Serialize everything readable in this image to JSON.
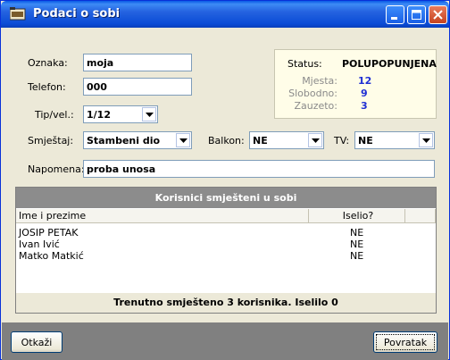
{
  "window": {
    "title": "Podaci o sobi"
  },
  "form": {
    "oznaka_label": "Oznaka:",
    "oznaka_value": "moja",
    "telefon_label": "Telefon:",
    "telefon_value": "000",
    "tip_label": "Tip/vel.:",
    "tip_value": "1/12",
    "smjestaj_label": "Smještaj:",
    "smjestaj_value": "Stambeni dio",
    "balkon_label": "Balkon:",
    "balkon_value": "NE",
    "tv_label": "TV:",
    "tv_value": "NE",
    "napomena_label": "Napomena:",
    "napomena_value": "proba unosa"
  },
  "status": {
    "status_label": "Status:",
    "status_value": "POLUPOPUNJENA",
    "mjesta_label": "Mjesta:",
    "mjesta_value": "12",
    "slobodno_label": "Slobodno:",
    "slobodno_value": "9",
    "zauzeto_label": "Zauzeto:",
    "zauzeto_value": "3",
    "value_color": "#1f2fd4"
  },
  "grid": {
    "title": "Korisnici smješteni u sobi",
    "columns": [
      "Ime i prezime",
      "Iselio?"
    ],
    "rows": [
      {
        "name": "JOSIP PETAK",
        "iselio": "NE"
      },
      {
        "name": "Ivan Ivić",
        "iselio": "NE"
      },
      {
        "name": "Matko Matkić",
        "iselio": "NE"
      }
    ],
    "footer": "Trenutno smješteno 3 korisnika. Iselilo 0"
  },
  "buttons": {
    "otkazi": "Otkaži",
    "povratak": "Povratak"
  },
  "icons": {
    "title": "window-app-icon",
    "minimize": "minimize-icon",
    "maximize": "maximize-icon",
    "close": "close-icon",
    "dropdown": "chevron-down-icon"
  },
  "colors": {
    "titlebar": "#0b4cd6",
    "grid_header": "#8c8c8c",
    "bottom_bar": "#808080"
  }
}
